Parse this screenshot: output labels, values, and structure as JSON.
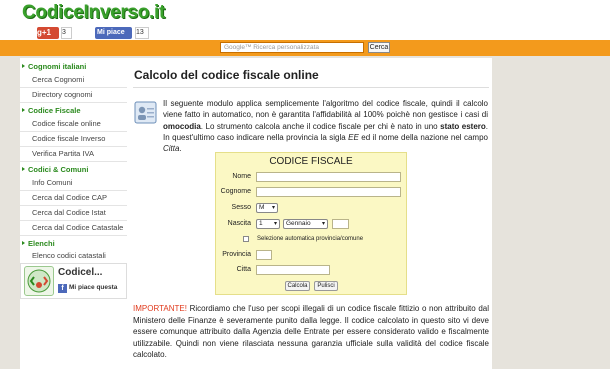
{
  "header": {
    "logo": "CodiceInverso.it",
    "gplus_label": "g+1",
    "gplus_count": "3",
    "fb_label": "Mi piace",
    "fb_count": "13",
    "search_placeholder": "Google™ Ricerca personalizzata",
    "search_button": "Cerca"
  },
  "sidebar": {
    "sections": [
      {
        "heading": "Cognomi italiani",
        "items": [
          "Cerca Cognomi",
          "Directory cognomi"
        ]
      },
      {
        "heading": "Codice Fiscale",
        "items": [
          "Codice fiscale online",
          "Codice fiscale Inverso",
          "Verifica Partita IVA"
        ]
      },
      {
        "heading": "Codici & Comuni",
        "items": [
          "Info Comuni",
          "Cerca dal Codice CAP",
          "Cerca dal Codice Istat",
          "Cerca dal Codice Catastale"
        ]
      },
      {
        "heading": "Elenchi",
        "items": [
          "Elenco codici catastali"
        ]
      }
    ],
    "widget": {
      "title": "Codicel...",
      "like_icon": "f",
      "like_label": "Mi piace questa"
    }
  },
  "main": {
    "title": "Calcolo del codice fiscale online",
    "intro_line1": "Il seguente modulo applica semplicemente l'algoritmo del codice fiscale, quindi il calcolo viene fatto in automatico, non è garantita l'affidabilità al 100% poichè non gestisce i casi di ",
    "intro_bold1": "omocodia",
    "intro_line2": ". Lo strumento calcola anche il codice fiscale per chi è nato in uno ",
    "intro_bold2": "stato estero",
    "intro_line3": ". In quest'ultimo caso indicare nella provincia la sigla ",
    "intro_italic1": "EE",
    "intro_line4": " ed il nome della nazione nel campo ",
    "intro_italic2": "Citta",
    "intro_end": ".",
    "form": {
      "title": "CODICE FISCALE",
      "nome_label": "Nome",
      "cognome_label": "Cognome",
      "sesso_label": "Sesso",
      "sesso_value": "M",
      "nascita_label": "Nascita",
      "giorno_value": "1",
      "mese_value": "Gennaio",
      "auto_label": "Selezione automatica provincia/comune",
      "provincia_label": "Provincia",
      "citta_label": "Citta",
      "calc_button": "Calcola",
      "reset_button": "Pulisci"
    },
    "warning_lead": "IMPORTANTE!",
    "warning_text": " Ricordiamo che l'uso per scopi illegali di un codice fiscale fittizio o non attribuito dal Ministero delle Finanze è severamente punito dalla legge. Il codice calcolato in questo sito vi deve essere comunque attribuito dalla Agenzia delle Entrate per essere considerato valido e fiscalmente utilizzabile. Quindi non viene rilasciata nessuna garanzia ufficiale sulla validità del codice fiscale calcolato."
  }
}
